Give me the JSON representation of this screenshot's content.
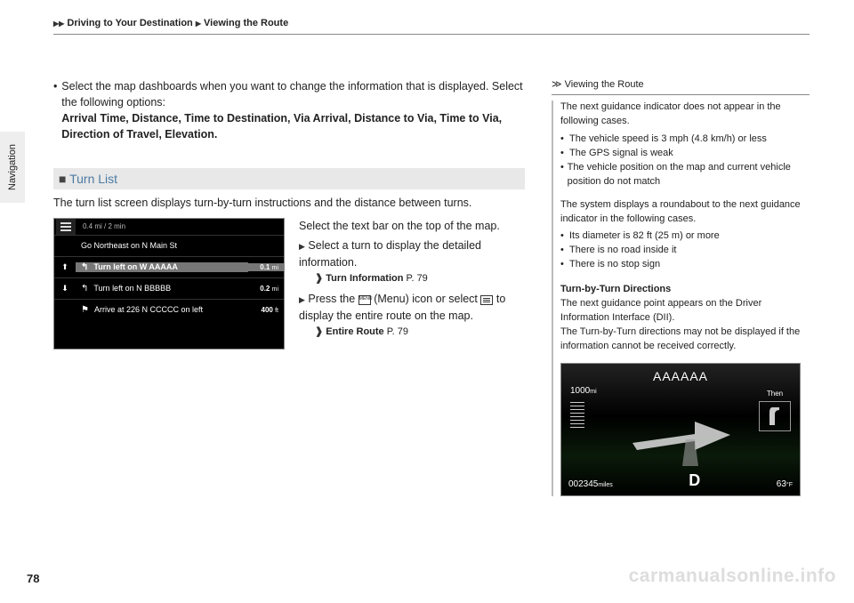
{
  "header": {
    "crumb1": "Driving to Your Destination",
    "crumb2": "Viewing the Route"
  },
  "side_tab": "Navigation",
  "page_number": "78",
  "left": {
    "bullet": "Select the map dashboards when you want to change the information that is displayed. Select the following options:",
    "options": "Arrival Time, Distance, Time to Destination, Via Arrival, Distance to Via, Time to Via, Direction of Travel, Elevation.",
    "section_title": "Turn List",
    "intro": "The turn list screen displays turn-by-turn instructions and the distance between turns.",
    "instruction1": "Select the text bar on the top of the map.",
    "sub1": "Select a turn to display the detailed information.",
    "ref1_label": "Turn Information",
    "ref1_page": "P. 79",
    "sub2a": "Press the",
    "sub2b": "(Menu) icon or select",
    "sub2c": "to display the entire route on the map.",
    "ref2_label": "Entire Route",
    "ref2_page": "P. 79"
  },
  "turn_list": {
    "timing": "0.4 mi / 2 min",
    "row1": "Go Northeast on N Main St",
    "row2": "Turn left on W AAAAA",
    "row2_dist": "0.1",
    "row2_unit": "mi",
    "row3": "Turn left on N BBBBB",
    "row3_dist": "0.2",
    "row3_unit": "mi",
    "row4": "Arrive at 226 N CCCCC  on left",
    "row4_dist": "400",
    "row4_unit": "ft"
  },
  "sidebar": {
    "title": "Viewing the Route",
    "intro": "The next guidance indicator does not appear in the following cases.",
    "b1": "The vehicle speed is 3 mph (4.8 km/h) or less",
    "b2": "The GPS signal is weak",
    "b3": "The vehicle position on the map and current vehicle position do not match",
    "p2": "The system displays a roundabout to the next guidance indicator in the following cases.",
    "c1": "Its diameter is 82 ft (25 m) or more",
    "c2": "There is no road inside it",
    "c3": "There is no stop sign",
    "sub": "Turn-by-Turn Directions",
    "p3": "The next guidance point appears on the Driver Information Interface (DII).",
    "p4": "The Turn-by-Turn directions may not be displayed if the information cannot be received correctly."
  },
  "dii": {
    "title": "AAAAAA",
    "gauge_top": "1000",
    "gauge_unit": "mi",
    "odo": "002345",
    "odo_unit": "miles",
    "gear": "D",
    "temp": "63",
    "temp_unit": "°F",
    "then": "Then"
  },
  "watermark": "carmanualsonline.info"
}
